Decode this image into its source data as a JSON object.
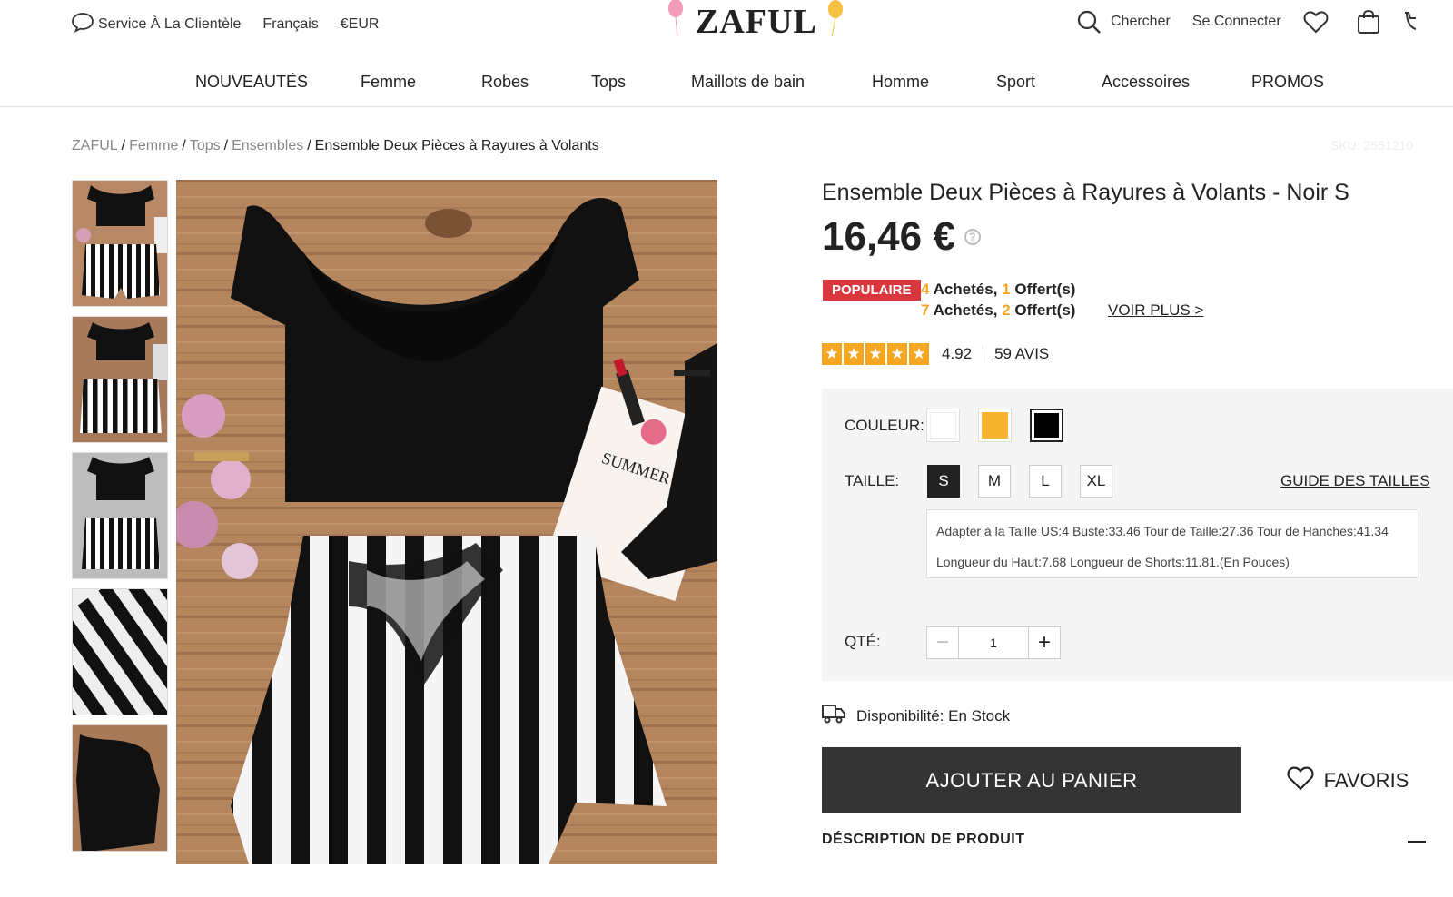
{
  "topbar": {
    "service": "Service À La Clientèle",
    "language": "Français",
    "currency": "€EUR",
    "logo": "ZAFUL",
    "search": "Chercher",
    "login": "Se Connecter"
  },
  "nav": {
    "items": [
      "NOUVEAUTÉS",
      "Femme",
      "Robes",
      "Tops",
      "Maillots de bain",
      "Homme",
      "Sport",
      "Accessoires",
      "PROMOS"
    ]
  },
  "breadcrumb": {
    "items": [
      "ZAFUL",
      "Femme",
      "Tops",
      "Ensembles"
    ],
    "current": "Ensemble Deux Pièces à Rayures à Volants",
    "sep": "/",
    "sku": "SKU: 2551210"
  },
  "product": {
    "title": "Ensemble Deux Pièces à Rayures à Volants - Noir S",
    "price": "16,46 €",
    "price_help": "?",
    "badge": "POPULAIRE",
    "stats": [
      {
        "bought": "4",
        "bought_label": "Achetés,",
        "offered": "1",
        "offered_label": "Offert(s)"
      },
      {
        "bought": "7",
        "bought_label": "Achetés,",
        "offered": "2",
        "offered_label": "Offert(s)"
      }
    ],
    "voir_plus": "VOIR PLUS >",
    "rating": "4.92",
    "reviews": "59 AVIS",
    "stars": 5
  },
  "options": {
    "color_label": "COULEUR:",
    "colors": [
      "#ffffff",
      "#f6b431",
      "#000000"
    ],
    "selected_color": 2,
    "size_label": "TAILLE:",
    "sizes": [
      "S",
      "M",
      "L",
      "XL"
    ],
    "selected_size": 0,
    "size_guide": "GUIDE DES TAILLES",
    "size_info": "Adapter à la Taille US:4    Buste:33.46    Tour de Taille:27.36    Tour de Hanches:41.34    Longueur du Haut:7.68    Longueur de Shorts:11.81.(En Pouces)",
    "qty_label": "QTÉ:",
    "qty": "1",
    "minus": "−",
    "plus": "+"
  },
  "stock": "Disponibilité: En Stock",
  "buttons": {
    "add_to_cart": "AJOUTER AU PANIER",
    "favorites": "FAVORIS"
  },
  "description_label": "DÉSCRIPTION DE PRODUIT"
}
